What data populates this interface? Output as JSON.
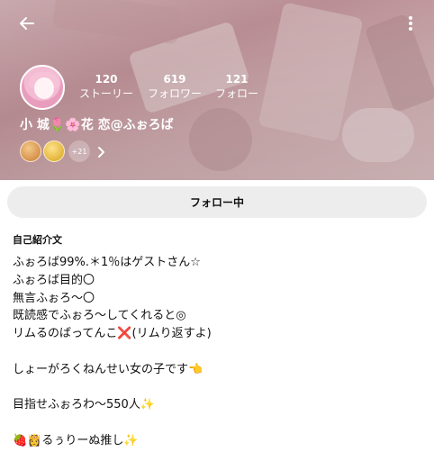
{
  "header": {
    "stats": [
      {
        "value": "120",
        "label": "ストーリー"
      },
      {
        "value": "619",
        "label": "フォロワー"
      },
      {
        "value": "121",
        "label": "フォロー"
      }
    ],
    "display_name": "小 城🌷🌸花 恋@ふぉろば",
    "badges_more": "+21"
  },
  "actions": {
    "follow_label": "フォロー中"
  },
  "bio": {
    "title": "自己紹介文",
    "lines": [
      "ふぉろば99%.＊1％はゲストさん☆",
      "ふぉろば目的〇",
      "無言ふぉろ～〇",
      "既読感でふぉろ～してくれると◎",
      "リムるのばってんこ❌(リムり返すよ)",
      "",
      "しょーがろくねんせい女の子です👈",
      "",
      "目指せふぉろわ～550人✨",
      "",
      "🍓👸るぅりーぬ推し✨"
    ]
  }
}
